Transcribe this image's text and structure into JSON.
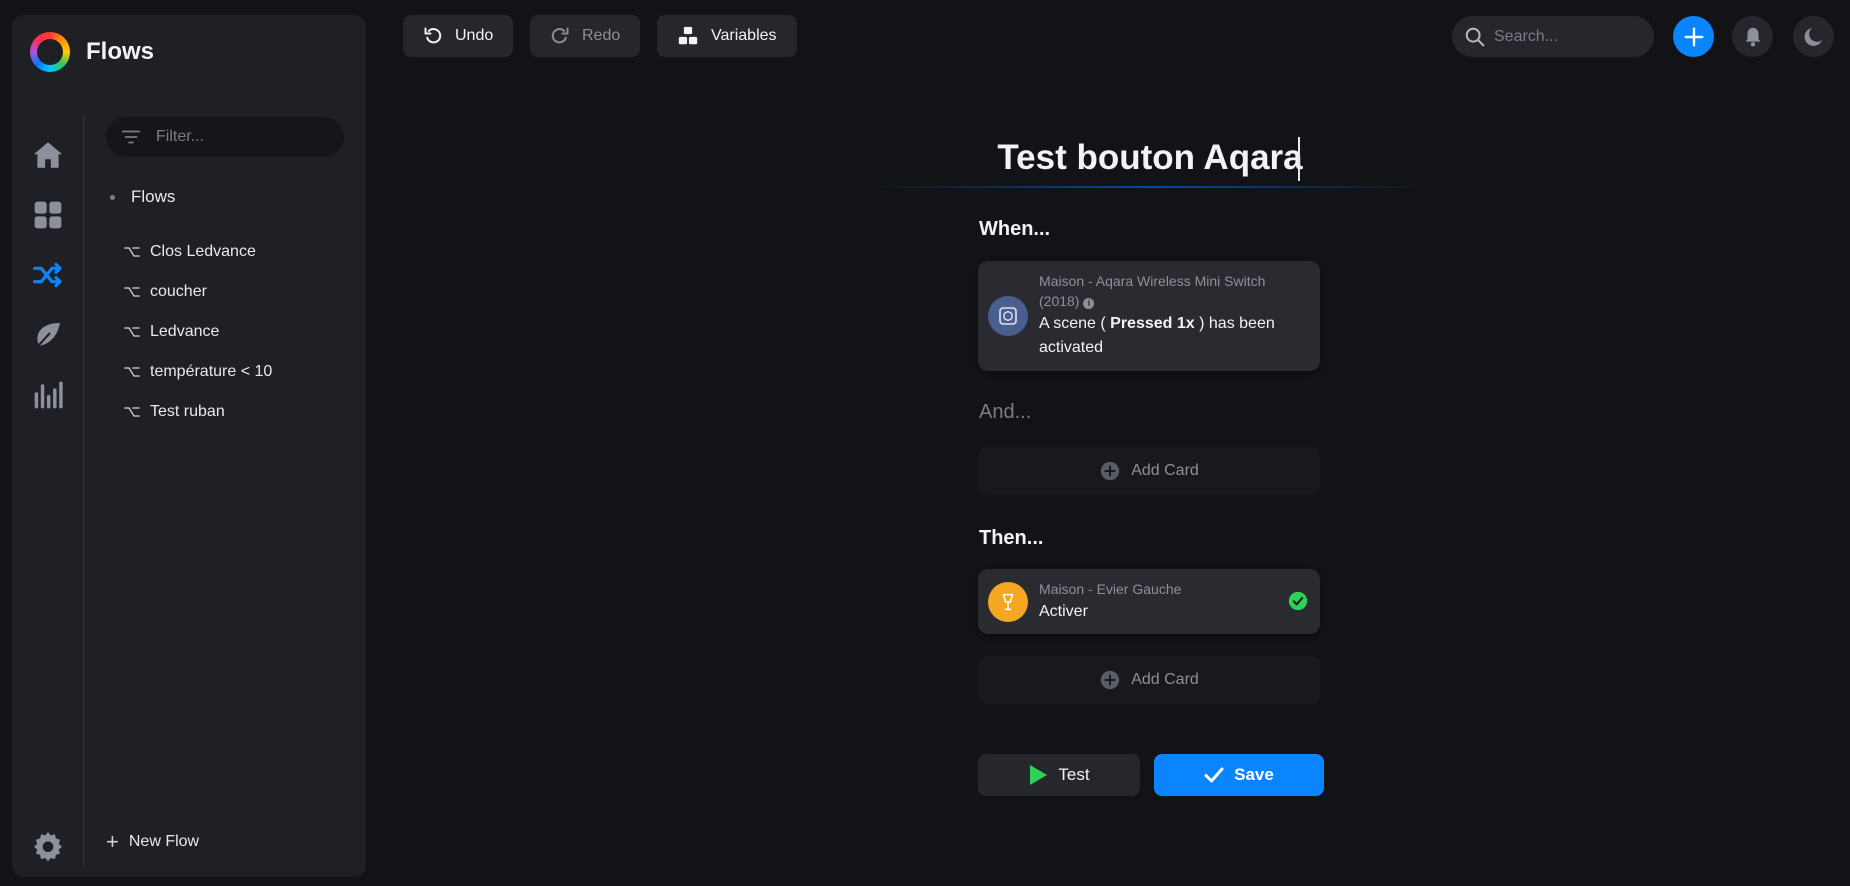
{
  "app": {
    "title": "Flows"
  },
  "colors": {
    "accent": "#0a84ff",
    "sidebar_bg": "#1f2026",
    "page_bg": "#121317",
    "success": "#30d158",
    "device_orange": "#f5a623"
  },
  "nav": {
    "items": [
      {
        "icon": "home-icon",
        "active": false
      },
      {
        "icon": "dashboard-icon",
        "active": false
      },
      {
        "icon": "flows-shuffle-icon",
        "active": true
      },
      {
        "icon": "leaf-icon",
        "active": false
      },
      {
        "icon": "insights-bars-icon",
        "active": false
      }
    ],
    "settings_icon": "gear-icon"
  },
  "filter": {
    "placeholder": "Filter..."
  },
  "tree": {
    "root": "Flows",
    "items": [
      {
        "label": "Clos Ledvance"
      },
      {
        "label": "coucher"
      },
      {
        "label": "Ledvance"
      },
      {
        "label": "température < 10"
      },
      {
        "label": "Test ruban"
      }
    ],
    "new_flow": "New Flow"
  },
  "toolbar": {
    "undo": "Undo",
    "redo": "Redo",
    "variables": "Variables"
  },
  "search": {
    "placeholder": "Search..."
  },
  "editor": {
    "flow_title": "Test bouton Aqara",
    "when_label": "When...",
    "and_label": "And...",
    "then_label": "Then...",
    "when_card": {
      "device": "Maison - Aqara Wireless Mini Switch",
      "device_year": "(2018)",
      "info_icon": "i",
      "text_before": "A scene (",
      "arg": "Pressed 1x",
      "text_after": ") has been activated"
    },
    "then_card": {
      "device": "Maison - Evier Gauche",
      "action": "Activer",
      "status": "ok"
    },
    "add_card_label": "Add Card",
    "test_button": "Test",
    "save_button": "Save"
  }
}
